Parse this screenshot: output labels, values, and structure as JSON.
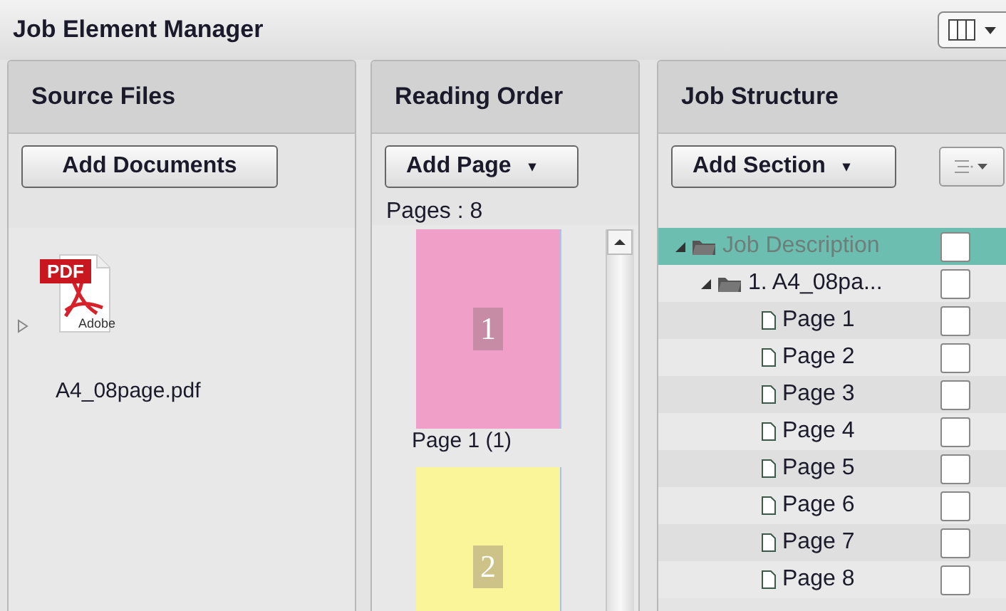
{
  "window": {
    "title": "Job Element Manager"
  },
  "source_files": {
    "title": "Source Files",
    "add_button": "Add Documents",
    "files": [
      {
        "name": "A4_08page.pdf",
        "icon_label": "PDF",
        "icon_brand": "Adobe",
        "expanded": false
      }
    ]
  },
  "reading_order": {
    "title": "Reading Order",
    "add_button": "Add Page",
    "caret": "▾",
    "count": "Pages : 8",
    "pages": [
      {
        "number": "1",
        "label": "Page 1 (1)",
        "color": "#f0a0c8"
      },
      {
        "number": "2",
        "color": "#fbf59a"
      }
    ]
  },
  "job_structure": {
    "title": "Job Structure",
    "add_button": "Add Section",
    "caret": "▾",
    "tree": [
      {
        "label": "Job Description",
        "selected": true,
        "expanded": true,
        "checked": false,
        "kind": "folder",
        "children": [
          {
            "label": "1. A4_08pa...",
            "selected": false,
            "expanded": true,
            "checked": false,
            "kind": "folder",
            "children": [
              {
                "label": "Page 1",
                "selected": false,
                "checked": false,
                "kind": "page"
              },
              {
                "label": "Page 2",
                "selected": false,
                "checked": false,
                "kind": "page"
              },
              {
                "label": "Page 3",
                "selected": false,
                "checked": false,
                "kind": "page"
              },
              {
                "label": "Page 4",
                "selected": false,
                "checked": false,
                "kind": "page"
              },
              {
                "label": "Page 5",
                "selected": false,
                "checked": false,
                "kind": "page"
              },
              {
                "label": "Page 6",
                "selected": false,
                "checked": false,
                "kind": "page"
              },
              {
                "label": "Page 7",
                "selected": false,
                "checked": false,
                "kind": "page"
              },
              {
                "label": "Page 8",
                "selected": false,
                "checked": false,
                "kind": "page"
              }
            ]
          }
        ]
      }
    ]
  }
}
